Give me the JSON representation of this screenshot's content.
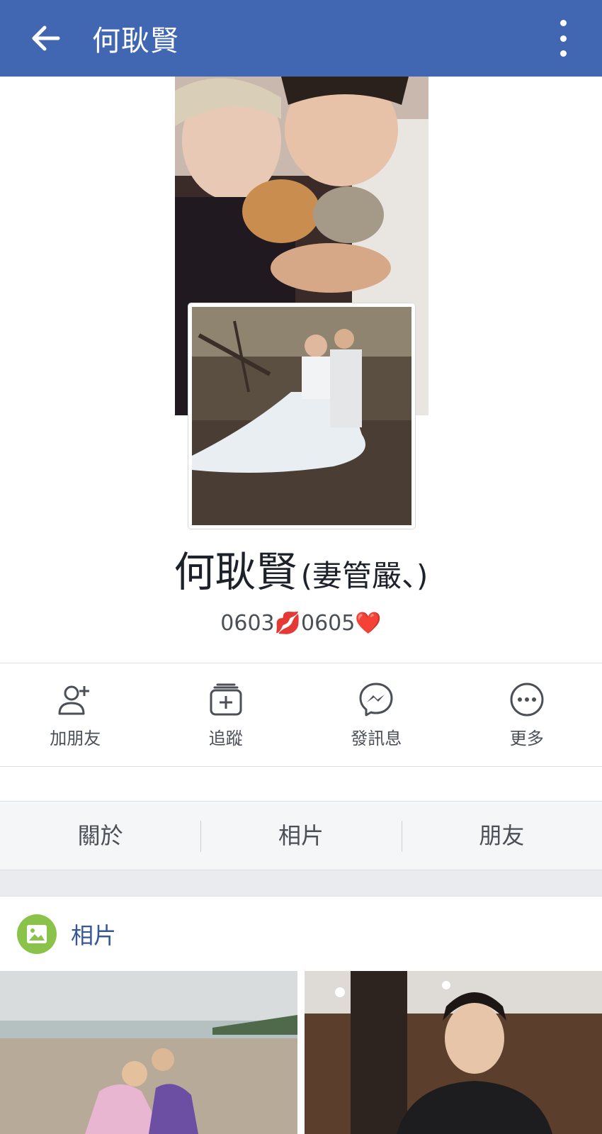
{
  "header": {
    "title": "何耿賢"
  },
  "profile": {
    "name": "何耿賢",
    "alternate_name": "(妻管嚴、)",
    "bio": {
      "first_date": "0603",
      "separator_emoji": "💋",
      "second_date": "0605",
      "end_emoji": "❤️"
    }
  },
  "actions": [
    {
      "label": "加朋友",
      "icon": "add-friend-icon"
    },
    {
      "label": "追蹤",
      "icon": "follow-icon"
    },
    {
      "label": "發訊息",
      "icon": "messenger-icon"
    },
    {
      "label": "更多",
      "icon": "more-icon"
    }
  ],
  "tabs": [
    {
      "label": "關於"
    },
    {
      "label": "相片"
    },
    {
      "label": "朋友"
    }
  ],
  "photos_section": {
    "title": "相片",
    "icon": "photo-icon"
  },
  "colors": {
    "brand_blue": "#4267b2",
    "link_blue": "#365899",
    "photos_green": "#8bc34a"
  }
}
